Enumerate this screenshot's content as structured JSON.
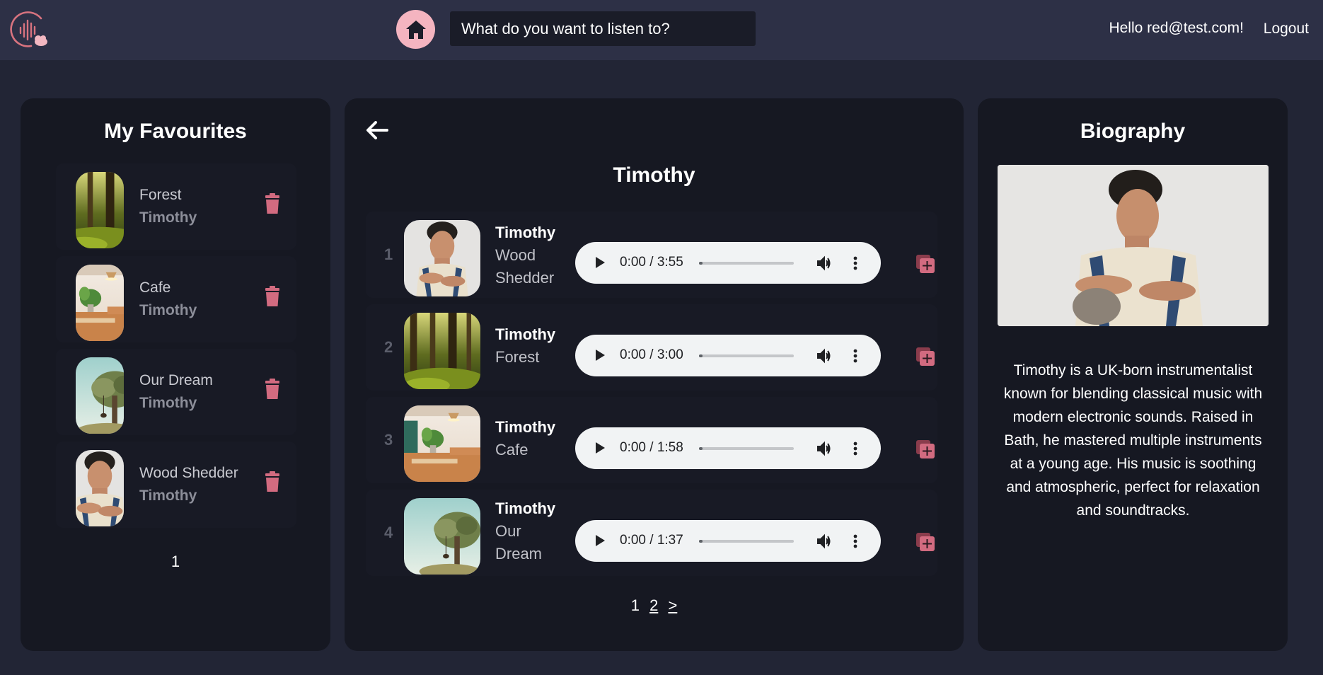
{
  "header": {
    "search_placeholder": "What do you want to listen to?",
    "greeting": "Hello red@test.com!",
    "logout_label": "Logout"
  },
  "favourites": {
    "title": "My Favourites",
    "items": [
      {
        "title": "Forest",
        "artist": "Timothy",
        "thumb": "forest"
      },
      {
        "title": "Cafe",
        "artist": "Timothy",
        "thumb": "cafe"
      },
      {
        "title": "Our Dream",
        "artist": "Timothy",
        "thumb": "tree"
      },
      {
        "title": "Wood Shedder",
        "artist": "Timothy",
        "thumb": "portrait"
      }
    ],
    "page": "1"
  },
  "main": {
    "title": "Timothy",
    "tracks": [
      {
        "number": "1",
        "artist": "Timothy",
        "title": "Wood Shedder",
        "time": "0:00 / 3:55",
        "progress": 0.0,
        "thumb": "portrait"
      },
      {
        "number": "2",
        "artist": "Timothy",
        "title": "Forest",
        "time": "0:00 / 3:00",
        "progress": 0.0,
        "thumb": "forest"
      },
      {
        "number": "3",
        "artist": "Timothy",
        "title": "Cafe",
        "time": "0:00 / 1:58",
        "progress": 0.0,
        "thumb": "cafe"
      },
      {
        "number": "4",
        "artist": "Timothy",
        "title": "Our Dream",
        "time": "0:00 / 1:37",
        "progress": 0.0,
        "thumb": "tree"
      }
    ],
    "pagination": {
      "current": "1",
      "next_page": "2",
      "next_label": ">"
    }
  },
  "biography": {
    "title": "Biography",
    "text": "Timothy is a UK-born instrumentalist known for blending classical music with modern electronic sounds. Raised in Bath, he mastered multiple instruments at a young age. His music is soothing and atmospheric, perfect for relaxation and soundtracks."
  },
  "colors": {
    "background": "#222535",
    "header": "#2d3046",
    "panel": "#161822",
    "accent_pink": "#f4b4c0",
    "trash_red": "#d26b80",
    "player_bg": "#f1f3f4"
  }
}
